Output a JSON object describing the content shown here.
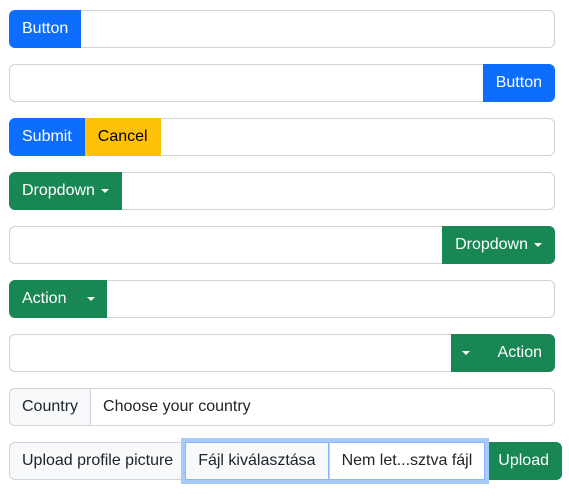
{
  "rows": {
    "button_left": {
      "button_label": "Button",
      "input_value": ""
    },
    "button_right": {
      "button_label": "Button",
      "input_value": ""
    },
    "submit_cancel": {
      "submit_label": "Submit",
      "cancel_label": "Cancel",
      "input_value": ""
    },
    "dropdown_left": {
      "button_label": "Dropdown",
      "input_value": ""
    },
    "dropdown_right": {
      "button_label": "Dropdown",
      "input_value": ""
    },
    "split_left": {
      "button_label": "Action",
      "input_value": ""
    },
    "split_right": {
      "button_label": "Action",
      "input_value": ""
    },
    "country": {
      "label": "Country",
      "select_value": "Choose your country"
    },
    "upload": {
      "label": "Upload profile picture",
      "choose_file_label": "Fájl kiválasztása",
      "file_name": "Nem let...sztva fájl",
      "upload_label": "Upload"
    }
  },
  "colors": {
    "primary": "#0d6efd",
    "warning": "#ffc107",
    "success": "#198754",
    "border": "#ced4da",
    "focus_ring": "#a8caf9"
  },
  "icons": {
    "dropdown_caret": "caret-down-icon"
  }
}
